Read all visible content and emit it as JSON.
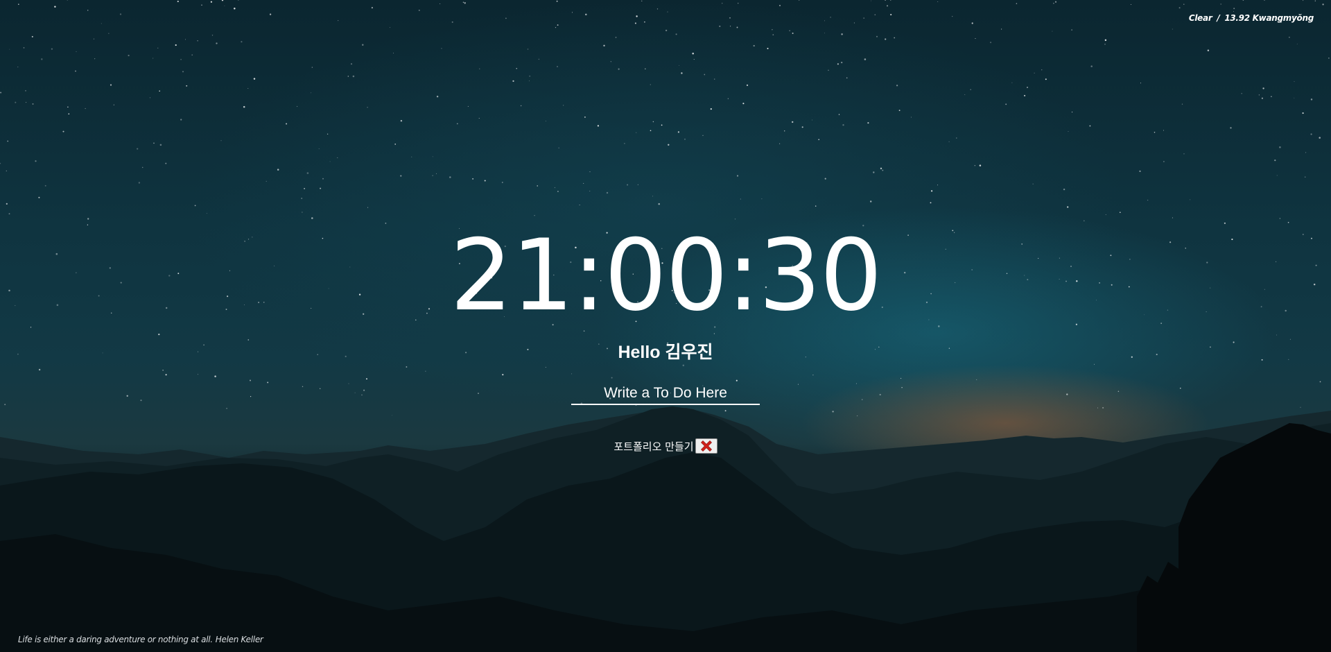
{
  "weather": {
    "condition": "Clear",
    "separator": "/",
    "temperature": "13.92",
    "location": "Kwangmyŏng"
  },
  "clock": {
    "time": "21:00:30"
  },
  "greeting": {
    "text": "Hello 김우진"
  },
  "todo_form": {
    "placeholder": "Write a To Do Here"
  },
  "todos": [
    {
      "text": "포트폴리오 만들기",
      "delete_icon": "red-x-icon"
    }
  ],
  "quote": {
    "text": "Life is either a daring adventure or nothing at all.",
    "author": "Helen Keller"
  },
  "colors": {
    "text": "#ffffff",
    "sky_top": "#0b2630",
    "sky_glow": "#196e82",
    "horizon_glow": "#a05f37",
    "mountains": "#0d1d22",
    "delete_x": "#d0201b"
  }
}
